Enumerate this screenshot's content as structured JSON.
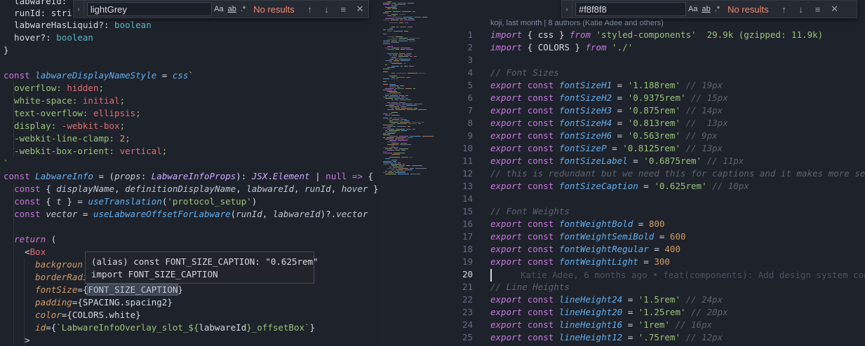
{
  "left_find": {
    "value": "lightGrey",
    "match_case": "Aa",
    "whole_word": "ab",
    "regex": ".*",
    "results": "No results"
  },
  "right_find": {
    "value": "#f8f8f8",
    "match_case": "Aa",
    "whole_word": "ab",
    "regex": ".*",
    "results": "No results"
  },
  "hover": {
    "line1": "(alias) const FONT_SIZE_CAPTION: \"0.625rem\"",
    "line2": "import FONT_SIZE_CAPTION"
  },
  "codelens": "koji, last month | 8 authors (Katie Adee and others)",
  "blame": "Katie Adee, 6 months ago • feat(components): Add design system const",
  "icons": [
    "chevron-right-icon",
    "arrow-up-icon",
    "arrow-down-icon",
    "selection-icon",
    "close-icon"
  ],
  "right_line_numbers": [
    "1",
    "2",
    "3",
    "4",
    "5",
    "6",
    "7",
    "8",
    "9",
    "10",
    "11",
    "12",
    "13",
    "14",
    "15",
    "16",
    "17",
    "18",
    "19",
    "20",
    "21",
    "22",
    "23",
    "24",
    "25"
  ],
  "active_line": "20"
}
